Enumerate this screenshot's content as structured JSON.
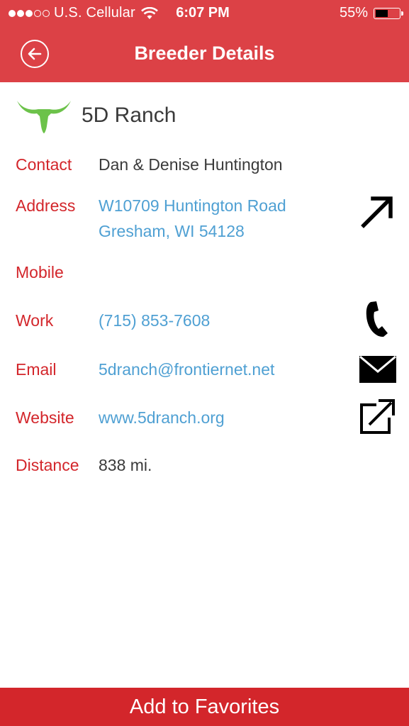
{
  "status_bar": {
    "carrier": "U.S. Cellular",
    "time": "6:07 PM",
    "battery_text": "55%",
    "battery_level": 0.55,
    "signal_bars_filled": 3,
    "signal_bars_total": 5
  },
  "nav": {
    "title": "Breeder Details",
    "back_icon": "back-arrow-circle-icon"
  },
  "breeder": {
    "name": "5D Ranch",
    "logo_icon": "longhorn-skull-icon"
  },
  "rows": {
    "contact": {
      "label": "Contact",
      "value": "Dan & Denise Huntington"
    },
    "address": {
      "label": "Address",
      "line1": "W10709 Huntington Road",
      "line2": "Gresham, WI 54128",
      "action_icon": "directions-arrow-icon"
    },
    "mobile": {
      "label": "Mobile",
      "value": ""
    },
    "work": {
      "label": "Work",
      "value": "(715) 853-7608",
      "action_icon": "phone-icon"
    },
    "email": {
      "label": "Email",
      "value": "5dranch@frontiernet.net",
      "action_icon": "mail-icon"
    },
    "website": {
      "label": "Website",
      "value": "www.5dranch.org",
      "action_icon": "external-link-icon"
    },
    "distance": {
      "label": "Distance",
      "value": "838 mi."
    }
  },
  "footer": {
    "button_label": "Add to Favorites"
  },
  "colors": {
    "header_red": "#dc4146",
    "label_red": "#d3262b",
    "link_blue": "#4fa0d3",
    "logo_green": "#6cc24a"
  }
}
